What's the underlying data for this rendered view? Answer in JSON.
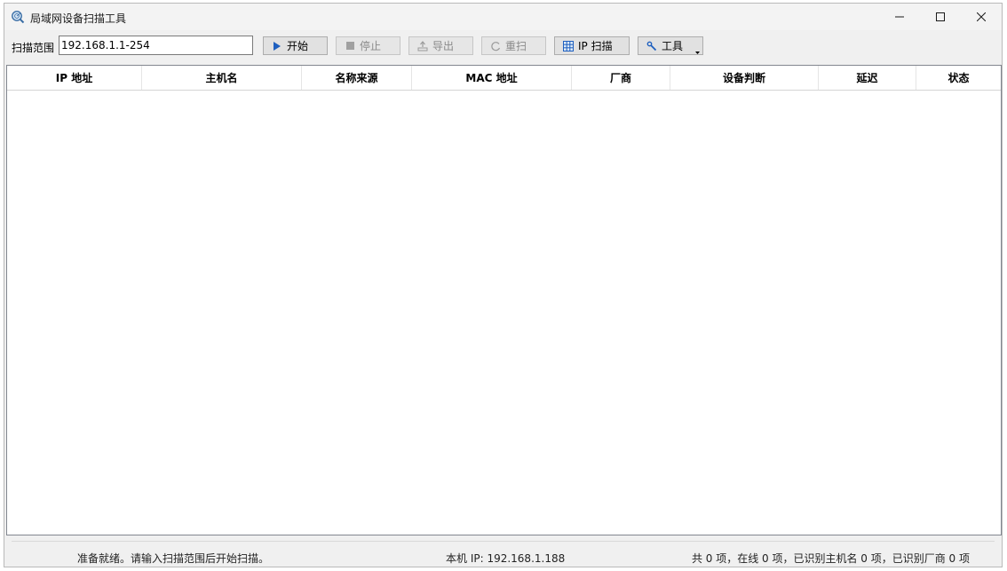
{
  "window": {
    "title": "局域网设备扫描工具"
  },
  "toolbar": {
    "range_label": "扫描范围",
    "range_value": "192.168.1.1-254",
    "buttons": {
      "start": "开始",
      "stop": "停止",
      "export": "导出",
      "rescan": "重扫",
      "ip_scan": "IP 扫描",
      "tools": "工具"
    }
  },
  "table": {
    "columns": [
      "IP 地址",
      "主机名",
      "名称来源",
      "MAC 地址",
      "厂商",
      "设备判断",
      "延迟",
      "状态"
    ],
    "rows": []
  },
  "status": {
    "message": "准备就绪。请输入扫描范围后开始扫描。",
    "local_ip": "本机 IP: 192.168.1.188",
    "summary": "共 0 项，在线 0 项，已识别主机名 0 项，已识别厂商 0 项"
  },
  "icons": {
    "app": "radar-search-icon",
    "start": "play-icon",
    "stop": "stop-icon",
    "export": "export-icon",
    "rescan": "refresh-icon",
    "ip_scan": "grid-icon",
    "tools": "wrench-icon"
  },
  "colors": {
    "accent": "#1e5fbf"
  }
}
